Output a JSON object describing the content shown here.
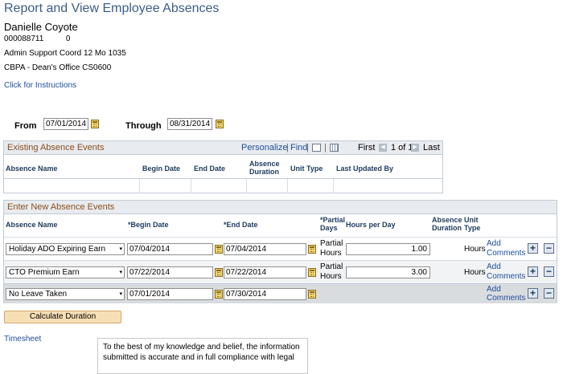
{
  "page": {
    "title": "Report and View Employee Absences",
    "employee_name": "Danielle Coyote",
    "employee_id": "000088711",
    "employee_record": "0",
    "job_title": "Admin Support Coord 12 Mo",
    "job_code": "1035",
    "department": "CBPA - Dean's Office",
    "dept_code": "CS0600",
    "instructions_link": "Click for Instructions"
  },
  "filters": {
    "from_label": "From",
    "from_value": "07/01/2014",
    "through_label": "Through",
    "through_value": "08/31/2014"
  },
  "existing": {
    "header": "Existing Absence Events",
    "personalize": "Personalize",
    "find": "Find",
    "nav_first": "First",
    "nav_range": "1 of 1",
    "nav_last": "Last",
    "columns": {
      "absence_name": "Absence Name",
      "begin_date": "Begin Date",
      "end_date": "End Date",
      "absence_duration_1": "Absence",
      "absence_duration_2": "Duration",
      "unit_type": "Unit Type",
      "last_updated_by": "Last Updated By"
    }
  },
  "new_events": {
    "header": "Enter New Absence Events",
    "columns": {
      "absence_name": "Absence Name",
      "begin_date": "*Begin Date",
      "end_date": "*End Date",
      "partial_1": "*Partial",
      "partial_2": "Days",
      "hours_per_day": "Hours per Day",
      "absence_1": "Absence",
      "absence_2": "Duration",
      "unit_1": "Unit",
      "unit_2": "Type"
    },
    "rows": [
      {
        "absence_name": "Holiday ADO Expiring Earn",
        "begin_date": "07/04/2014",
        "end_date": "07/04/2014",
        "partial_1": "Partial",
        "partial_2": "Hours",
        "hours_per_day": "1.00",
        "unit": "Hours",
        "comments_1": "Add",
        "comments_2": "Comments"
      },
      {
        "absence_name": "CTO Premium Earn",
        "begin_date": "07/22/2014",
        "end_date": "07/22/2014",
        "partial_1": "Partial",
        "partial_2": "Hours",
        "hours_per_day": "3.00",
        "unit": "Hours",
        "comments_1": "Add",
        "comments_2": "Comments"
      },
      {
        "absence_name": "No Leave Taken",
        "begin_date": "07/01/2014",
        "end_date": "07/30/2014",
        "comments_1": "Add",
        "comments_2": "Comments"
      }
    ]
  },
  "calculate_button": "Calculate Duration",
  "timesheet": {
    "label": "Timesheet",
    "text_1": "To the best of my knowledge and belief, the information",
    "text_2": "submitted is accurate and in full compliance with legal"
  }
}
